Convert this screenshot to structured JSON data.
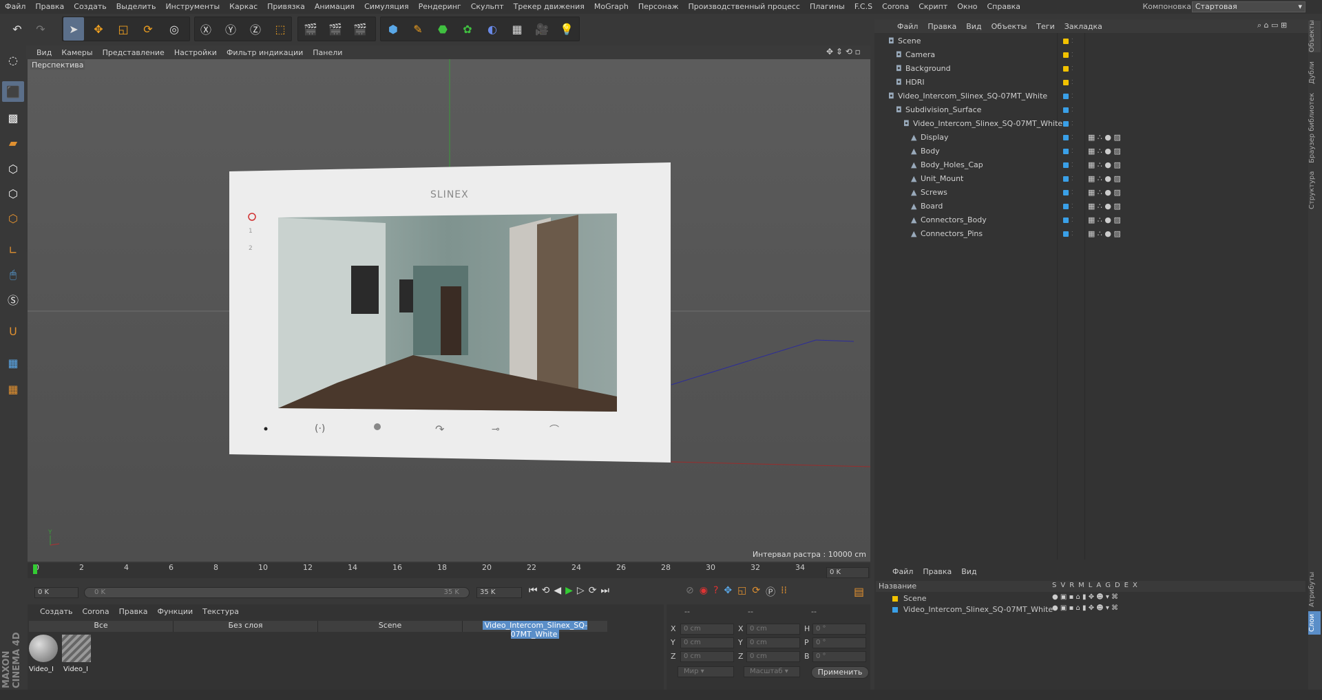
{
  "menubar": {
    "items": [
      "Файл",
      "Правка",
      "Создать",
      "Выделить",
      "Инструменты",
      "Каркас",
      "Привязка",
      "Анимация",
      "Симуляция",
      "Рендеринг",
      "Скульпт",
      "Трекер движения",
      "MoGraph",
      "Персонаж",
      "Производственный процесс",
      "Плагины",
      "F.C.S",
      "Corona",
      "Скрипт",
      "Окно",
      "Справка"
    ],
    "layout_label": "Компоновка",
    "layout_value": "Стартовая"
  },
  "viewport": {
    "menu": [
      "Вид",
      "Камеры",
      "Представление",
      "Настройки",
      "Фильтр индикации",
      "Панели"
    ],
    "label": "Перспектива",
    "raster": "Интервал растра : 10000 cm",
    "screen_brand": "SLINEX",
    "screen_buttons": [
      "1",
      "2"
    ]
  },
  "object_manager": {
    "menu": [
      "Файл",
      "Правка",
      "Вид",
      "Объекты",
      "Теги",
      "Закладка"
    ],
    "items": [
      {
        "name": "Scene",
        "indent": 0,
        "color": "#f2c200"
      },
      {
        "name": "Camera",
        "indent": 1,
        "color": "#f2c200"
      },
      {
        "name": "Background",
        "indent": 1,
        "color": "#f2c200"
      },
      {
        "name": "HDRI",
        "indent": 1,
        "color": "#f2c200"
      },
      {
        "name": "Video_Intercom_Slinex_SQ-07MT_White",
        "indent": 0,
        "color": "#3aa0e8"
      },
      {
        "name": "Subdivision_Surface",
        "indent": 1,
        "color": "#3aa0e8"
      },
      {
        "name": "Video_Intercom_Slinex_SQ-07MT_White",
        "indent": 2,
        "color": "#3aa0e8"
      },
      {
        "name": "Display",
        "indent": 3,
        "color": "#3aa0e8"
      },
      {
        "name": "Body",
        "indent": 3,
        "color": "#3aa0e8"
      },
      {
        "name": "Body_Holes_Cap",
        "indent": 3,
        "color": "#3aa0e8"
      },
      {
        "name": "Unit_Mount",
        "indent": 3,
        "color": "#3aa0e8"
      },
      {
        "name": "Screws",
        "indent": 3,
        "color": "#3aa0e8"
      },
      {
        "name": "Board",
        "indent": 3,
        "color": "#3aa0e8"
      },
      {
        "name": "Connectors_Body",
        "indent": 3,
        "color": "#3aa0e8"
      },
      {
        "name": "Connectors_Pins",
        "indent": 3,
        "color": "#3aa0e8"
      }
    ]
  },
  "side_tabs": [
    "Объекты",
    "Дубли",
    "Браузер библиотек",
    "Структура"
  ],
  "timeline": {
    "ticks": [
      "0",
      "2",
      "4",
      "6",
      "8",
      "10",
      "12",
      "14",
      "16",
      "18",
      "20",
      "22",
      "24",
      "26",
      "28",
      "30",
      "32",
      "34"
    ],
    "end_field": "0 K",
    "start_field": "0 K",
    "slider_left": "0 K",
    "slider_right": "35 K",
    "max_field": "35 K"
  },
  "material_manager": {
    "menu": [
      "Создать",
      "Corona",
      "Правка",
      "Функции",
      "Текстура"
    ],
    "filters": [
      "Все",
      "Без слоя",
      "Scene",
      "Video_Intercom_Slinex_SQ-07MT_White"
    ],
    "materials": [
      "Video_I",
      "Video_I"
    ]
  },
  "coordinates": {
    "rows": [
      {
        "a": "X",
        "av": "0 cm",
        "b": "X",
        "bv": "0 cm",
        "c": "H",
        "cv": "0 °"
      },
      {
        "a": "Y",
        "av": "0 cm",
        "b": "Y",
        "bv": "0 cm",
        "c": "P",
        "cv": "0 °"
      },
      {
        "a": "Z",
        "av": "0 cm",
        "b": "Z",
        "bv": "0 cm",
        "c": "B",
        "cv": "0 °"
      }
    ],
    "mode1": "Мир",
    "mode2": "Масштаб",
    "apply": "Применить",
    "dashes": "--"
  },
  "layer_manager": {
    "menu": [
      "Файл",
      "Правка",
      "Вид"
    ],
    "header": "Название",
    "cols": [
      "S",
      "V",
      "R",
      "M",
      "L",
      "A",
      "G",
      "D",
      "E",
      "X"
    ],
    "layers": [
      {
        "name": "Scene",
        "color": "#f2c200"
      },
      {
        "name": "Video_Intercom_Slinex_SQ-07MT_White",
        "color": "#3aa0e8"
      }
    ]
  },
  "attr_tabs": [
    "Атрибуты",
    "Слои"
  ],
  "brand": "MAXON CINEMA 4D"
}
